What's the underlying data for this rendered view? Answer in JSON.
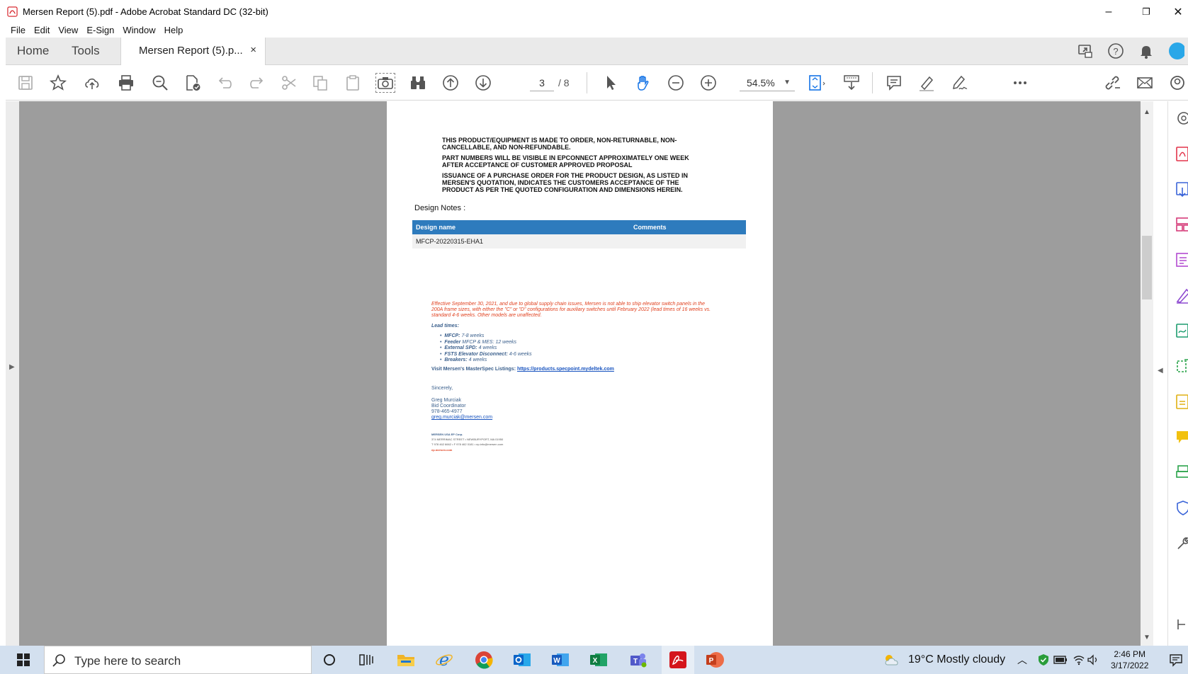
{
  "window": {
    "title": "Mersen Report (5).pdf - Adobe Acrobat Standard DC (32-bit)",
    "minimize": "–",
    "restore": "❐",
    "close": "✕"
  },
  "menu": [
    "File",
    "Edit",
    "View",
    "E-Sign",
    "Window",
    "Help"
  ],
  "tabs": {
    "home": "Home",
    "tools": "Tools",
    "document": "Mersen Report (5).p...",
    "close": "×"
  },
  "toolbar": {
    "current_page": "3",
    "total_pages": "/ 8",
    "zoom": "54.5%"
  },
  "document": {
    "notice_lines": [
      "THIS PRODUCT/EQUIPMENT IS MADE TO ORDER, NON-RETURNABLE, NON-CANCELLABLE, AND NON-REFUNDABLE.",
      "PART NUMBERS WILL BE VISIBLE IN EPCONNECT APPROXIMATELY ONE WEEK AFTER ACCEPTANCE OF CUSTOMER APPROVED PROPOSAL",
      "ISSUANCE OF A PURCHASE ORDER FOR THE PRODUCT DESIGN, AS LISTED IN MERSEN'S QUOTATION, INDICATES THE CUSTOMERS ACCEPTANCE OF THE PRODUCT AS PER THE QUOTED CONFIGURATION AND DIMENSIONS HEREIN."
    ],
    "design_notes_title": "Design Notes :",
    "table": {
      "headers": [
        "Design name",
        "Comments"
      ],
      "rows": [
        [
          "MFCP-20220315-EHA1",
          ""
        ]
      ]
    },
    "supply_notice": "Effective September 30, 2021, and due to global supply chain issues, Mersen is not able to ship elevator switch panels in the 200A frame sizes, with either the \"C\" or \"D\" configurations for auxiliary switches until February 2022 (lead times of 16 weeks vs. standard 4-6 weeks. Other models are unaffected.",
    "lead_times_title": "Lead times:",
    "lead_times": [
      {
        "label": "MFCP:",
        "value": "7-8 weeks"
      },
      {
        "label": "Feeder",
        "value": "MFCP & MES: 12 weeks"
      },
      {
        "label": "External SPD:",
        "value": "4 weeks"
      },
      {
        "label": "FSTS Elevator Disconnect:",
        "value": "4-6 weeks"
      },
      {
        "label": "Breakers:",
        "value": "4 weeks"
      }
    ],
    "visit_text": "Visit Mersen's MasterSpec Listings:",
    "visit_link": "https://products.specpoint.mydeltek.com",
    "closing": "Sincerely,",
    "signature": {
      "name": "Greg Murciak",
      "title": "Bid Coordinator",
      "phone": "978-465-4977",
      "email": "greg.murciak@mersen.com"
    },
    "footer": {
      "company": "MERSEN USA EP Corp.",
      "address": "374 MERRIMAC STREET • NEWBURYPORT, MA 01950",
      "contact": "T 978 462 6662 • F 978 462 0181 • ep.info@mersen.com",
      "web": "ep.mersen.com"
    }
  },
  "taskbar": {
    "search_placeholder": "Type here to search",
    "weather": "19°C  Mostly cloudy",
    "time": "2:46 PM",
    "date": "3/17/2022"
  },
  "colors": {
    "accent": "#1473e6",
    "table_header": "#2e7bbd",
    "notice_red": "#e0401e",
    "body_blue": "#3a5f8c",
    "workspace_gray": "#9d9d9d"
  }
}
